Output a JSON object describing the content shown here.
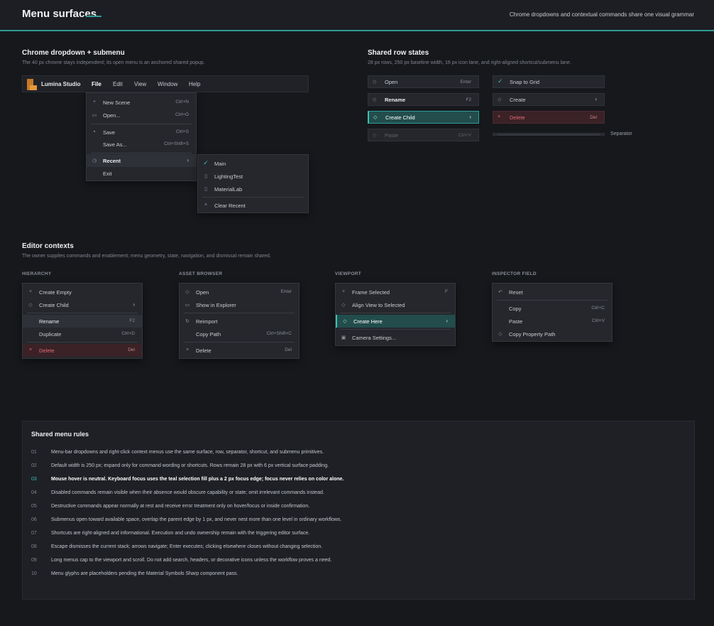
{
  "header": {
    "title": "Menu surfaces",
    "subtitle": "Chrome dropdowns and contextual commands share one visual grammar"
  },
  "chrome": {
    "title": "Chrome dropdown + submenu",
    "desc": "The 40 px chrome stays independent; its open menu is an anchored shared popup.",
    "brand": "Lumina Studio",
    "menus": [
      "File",
      "Edit",
      "View",
      "Window",
      "Help"
    ],
    "file_menu": [
      {
        "icon": "+",
        "label": "New Scene",
        "shortcut": "Ctrl+N"
      },
      {
        "icon": "▭",
        "label": "Open...",
        "shortcut": "Ctrl+O"
      },
      {
        "icon": "▪",
        "label": "Save",
        "shortcut": "Ctrl+S"
      },
      {
        "icon": "",
        "label": "Save As...",
        "shortcut": "Ctrl+Shift+S"
      },
      {
        "icon": "◷",
        "label": "Recent",
        "chevron": "›"
      },
      {
        "icon": "",
        "label": "Exit"
      }
    ],
    "recent_menu": [
      {
        "icon": "✓",
        "label": "Main"
      },
      {
        "icon": "▯",
        "label": "LightingTest"
      },
      {
        "icon": "▯",
        "label": "MaterialLab"
      },
      {
        "icon": "×",
        "label": "Clear Recent"
      }
    ]
  },
  "states": {
    "title": "Shared row states",
    "desc": "28 px rows, 250 px baseline width, 16 px icon lane, and right-aligned shortcut/submenu lane.",
    "left": [
      {
        "icon": "◇",
        "label": "Open",
        "shortcut": "Enter"
      },
      {
        "icon": "◇",
        "label": "Rename",
        "shortcut": "F2"
      },
      {
        "icon": "◇",
        "label": "Create Child",
        "chevron": "›"
      },
      {
        "icon": "◇",
        "label": "Paste",
        "shortcut": "Ctrl+V"
      }
    ],
    "right": [
      {
        "icon": "✓",
        "label": "Snap to Grid"
      },
      {
        "icon": "◇",
        "label": "Create",
        "chevron": "›"
      },
      {
        "icon": "×",
        "label": "Delete",
        "shortcut": "Del"
      }
    ],
    "separator_label": "Separator"
  },
  "contexts": {
    "title": "Editor contexts",
    "desc": "The owner supplies commands and enablement; menu geometry, state, navigation, and dismissal remain shared.",
    "hierarchy": {
      "label": "HIERARCHY",
      "items": [
        {
          "icon": "+",
          "label": "Create Empty"
        },
        {
          "icon": "◇",
          "label": "Create Child",
          "chevron": "›"
        },
        {
          "icon": "",
          "label": "Rename",
          "shortcut": "F2"
        },
        {
          "icon": "",
          "label": "Duplicate",
          "shortcut": "Ctrl+D"
        },
        {
          "icon": "×",
          "label": "Delete",
          "shortcut": "Del"
        }
      ]
    },
    "asset": {
      "label": "ASSET BROWSER",
      "items": [
        {
          "icon": "◇",
          "label": "Open",
          "shortcut": "Enter"
        },
        {
          "icon": "▭",
          "label": "Show in Explorer"
        },
        {
          "icon": "↻",
          "label": "Reimport"
        },
        {
          "icon": "",
          "label": "Copy Path",
          "shortcut": "Ctrl+Shift+C"
        },
        {
          "icon": "×",
          "label": "Delete",
          "shortcut": "Del"
        }
      ]
    },
    "viewport": {
      "label": "VIEWPORT",
      "items": [
        {
          "icon": "+",
          "label": "Frame Selected",
          "shortcut": "F"
        },
        {
          "icon": "◇",
          "label": "Align View to Selected"
        },
        {
          "icon": "◇",
          "label": "Create Here",
          "chevron": "›"
        },
        {
          "icon": "▣",
          "label": "Camera Settings..."
        }
      ]
    },
    "inspector": {
      "label": "INSPECTOR FIELD",
      "items": [
        {
          "icon": "↶",
          "label": "Reset"
        },
        {
          "icon": "",
          "label": "Copy",
          "shortcut": "Ctrl+C"
        },
        {
          "icon": "",
          "label": "Paste",
          "shortcut": "Ctrl+V"
        },
        {
          "icon": "◇",
          "label": "Copy Property Path"
        }
      ]
    }
  },
  "rules": {
    "title": "Shared menu rules",
    "items": [
      {
        "num": "01",
        "text": "Menu-bar dropdowns and right-click context menus use the same surface, row, separator, shortcut, and submenu primitives."
      },
      {
        "num": "02",
        "text": "Default width is 250 px; expand only for command wording or shortcuts. Rows remain 28 px with 6 px vertical surface padding."
      },
      {
        "num": "03",
        "text": "Mouse hover is neutral. Keyboard focus uses the teal selection fill plus a 2 px focus edge; focus never relies on color alone."
      },
      {
        "num": "04",
        "text": "Disabled commands remain visible when their absence would obscure capability or state; omit irrelevant commands instead."
      },
      {
        "num": "05",
        "text": "Destructive commands appear normally at rest and receive error treatment only on hover/focus or inside confirmation."
      },
      {
        "num": "06",
        "text": "Submenus open toward available space, overlap the parent edge by 1 px, and never nest more than one level in ordinary workflows."
      },
      {
        "num": "07",
        "text": "Shortcuts are right-aligned and informational. Execution and undo ownership remain with the triggering editor surface."
      },
      {
        "num": "08",
        "text": "Escape dismisses the current stack; arrows navigate; Enter executes; clicking elsewhere closes without changing selection."
      },
      {
        "num": "09",
        "text": "Long menus cap to the viewport and scroll. Do not add search, headers, or decorative icons unless the workflow proves a need."
      },
      {
        "num": "10",
        "text": "Menu glyphs are placeholders pending the Material Symbols Sharp component pass."
      }
    ]
  }
}
